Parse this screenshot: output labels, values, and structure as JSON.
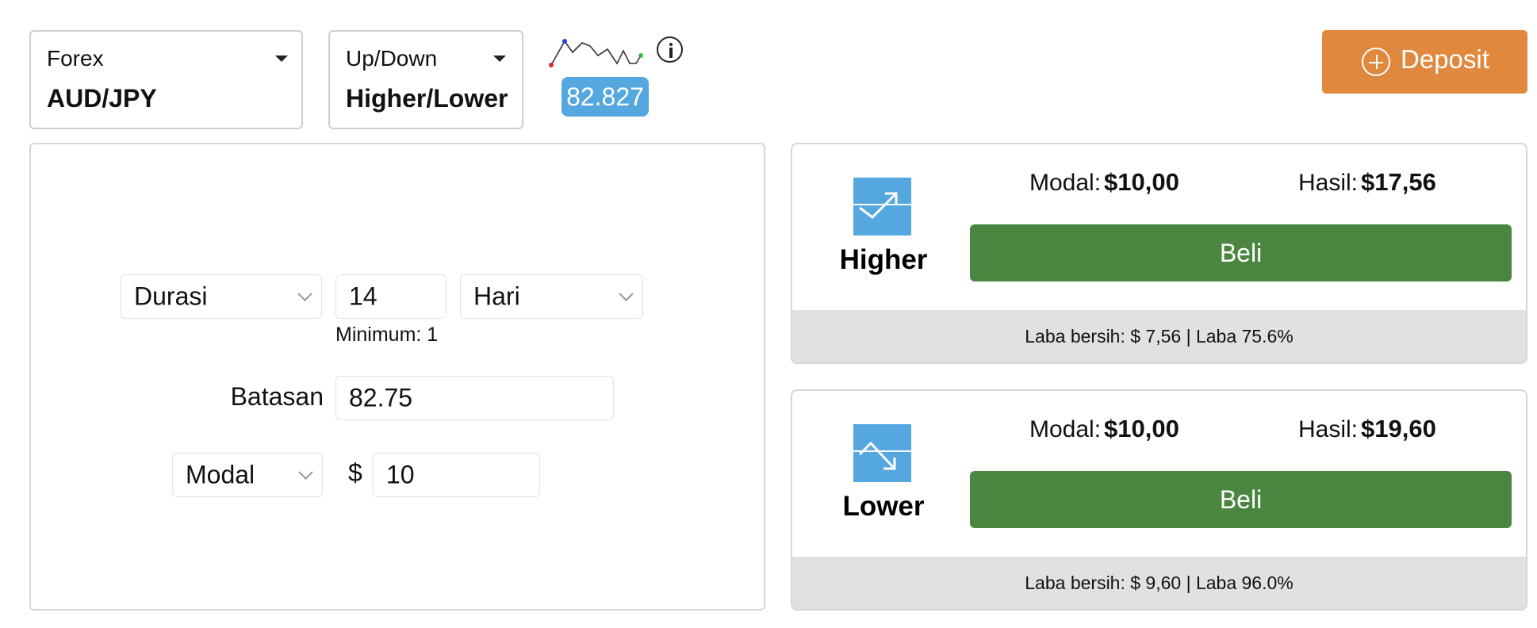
{
  "market": {
    "category": "Forex",
    "asset": "AUD/JPY"
  },
  "trade_type": {
    "category": "Up/Down",
    "type": "Higher/Lower"
  },
  "price": {
    "current": "82.827",
    "info_icon": "info-icon"
  },
  "deposit": {
    "label": "Deposit",
    "icon": "plus-circle-icon",
    "color": "#e0893e"
  },
  "form": {
    "duration": {
      "select": "Durasi",
      "value": "14",
      "unit": "Hari",
      "hint": "Minimum: 1"
    },
    "barrier": {
      "label": "Batasan",
      "value": "82.75"
    },
    "stake": {
      "select": "Modal",
      "currency": "$",
      "value": "10"
    }
  },
  "higher": {
    "label": "Higher",
    "stake_label": "Modal:",
    "stake_value": "$10,00",
    "payout_label": "Hasil:",
    "payout_value": "$17,56",
    "button": "Beli",
    "footer": "Laba bersih: $ 7,56 | Laba 75.6%"
  },
  "lower": {
    "label": "Lower",
    "stake_label": "Modal:",
    "stake_value": "$10,00",
    "payout_label": "Hasil:",
    "payout_value": "$19,60",
    "button": "Beli",
    "footer": "Laba bersih: $ 9,60 | Laba 96.0%"
  },
  "colors": {
    "buy_button": "#4b8641",
    "price_badge": "#55a7e0",
    "icon_bg": "#55a7e0"
  }
}
